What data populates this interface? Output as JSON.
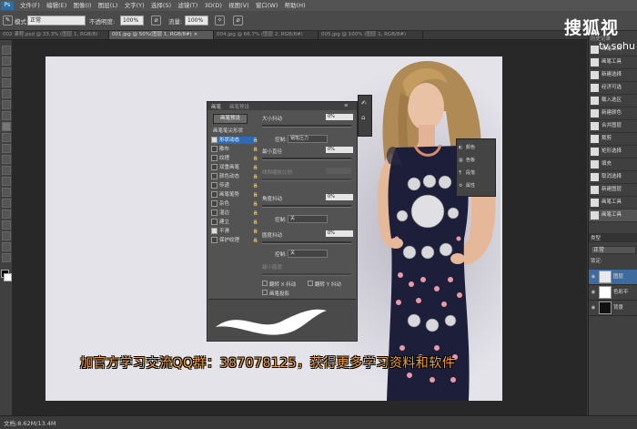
{
  "menu": {
    "logo": "Ps",
    "items": [
      "文件(F)",
      "编辑(E)",
      "图像(I)",
      "图层(L)",
      "文字(Y)",
      "选择(S)",
      "滤镜(T)",
      "3D(D)",
      "视图(V)",
      "窗口(W)",
      "帮助(H)"
    ]
  },
  "options": {
    "mode_label": "模式:",
    "mode_value": "正常",
    "opacity_label": "不透明度:",
    "opacity_value": "100%",
    "flow_label": "流量:",
    "flow_value": "100%"
  },
  "tabs": [
    "001.jpg @ 50%(图层 1, RGB/8#) ×",
    "002 课程.psd @ 33.3% (图层 1, RGB/8)",
    "004.jpg @ 66.7% (图层 2, RGB/8#)",
    "005.jpg @ 100% (图层 1, RGB/8#)"
  ],
  "brush_panel": {
    "tab_brush": "画笔",
    "tab_presets": "画笔预设",
    "preset_button": "画笔预设",
    "tip_shape": "画笔笔尖形状",
    "options": [
      {
        "label": "形状动态",
        "checked": true,
        "selected": true
      },
      {
        "label": "散布",
        "checked": false,
        "selected": false
      },
      {
        "label": "纹理",
        "checked": false,
        "selected": false
      },
      {
        "label": "双重画笔",
        "checked": false,
        "selected": false
      },
      {
        "label": "颜色动态",
        "checked": false,
        "selected": false
      },
      {
        "label": "传递",
        "checked": false,
        "selected": false
      },
      {
        "label": "画笔笔势",
        "checked": false,
        "selected": false
      },
      {
        "label": "杂色",
        "checked": false,
        "selected": false
      },
      {
        "label": "湿边",
        "checked": false,
        "selected": false
      },
      {
        "label": "建立",
        "checked": false,
        "selected": false
      },
      {
        "label": "平滑",
        "checked": true,
        "selected": false
      },
      {
        "label": "保护纹理",
        "checked": false,
        "selected": false
      }
    ],
    "size_jitter_label": "大小抖动",
    "size_jitter_value": "0%",
    "control_label": "控制:",
    "control_value": "钢笔压力",
    "min_diameter_label": "最小直径",
    "min_diameter_value": "0%",
    "tilt_scale_label": "倾斜缩放比例",
    "angle_jitter_label": "角度抖动",
    "angle_jitter_value": "0%",
    "control2_label": "控制:",
    "control2_value": "关",
    "roundness_jitter_label": "圆度抖动",
    "roundness_jitter_value": "0%",
    "control3_label": "控制:",
    "control3_value": "关",
    "min_roundness_label": "最小圆度",
    "flip_x_label": "翻转 X 抖动",
    "flip_y_label": "翻转 Y 抖动",
    "brush_projection_label": "画笔投影"
  },
  "mini_panel": {
    "items": [
      "颜色",
      "色板",
      "段落",
      "属性"
    ]
  },
  "history": {
    "header": "历史记录",
    "items": [
      "画笔工具",
      "画笔工具",
      "新建选择",
      "经济可选",
      "载入选区",
      "新建颜色",
      "合并图层",
      "裁剪",
      "矩形选择",
      "填充",
      "取消选择",
      "新建图层",
      "画笔工具",
      "画笔工具"
    ]
  },
  "layers": {
    "kind_label": "类型",
    "mode": "正常",
    "lock_label": "锁定:",
    "items": [
      {
        "name": "图层",
        "color": "#e8e8ee"
      },
      {
        "name": "色彩平",
        "color": "#ffffff"
      },
      {
        "name": "背景",
        "color": "#111111"
      }
    ]
  },
  "status": {
    "doc_info": "文档:8.62M/13.4M"
  },
  "watermark": {
    "brand": "搜狐视",
    "url": "tv.sohu"
  },
  "caption": "加官方学习交流QQ群：387078125，获得更多学习资料和软件"
}
